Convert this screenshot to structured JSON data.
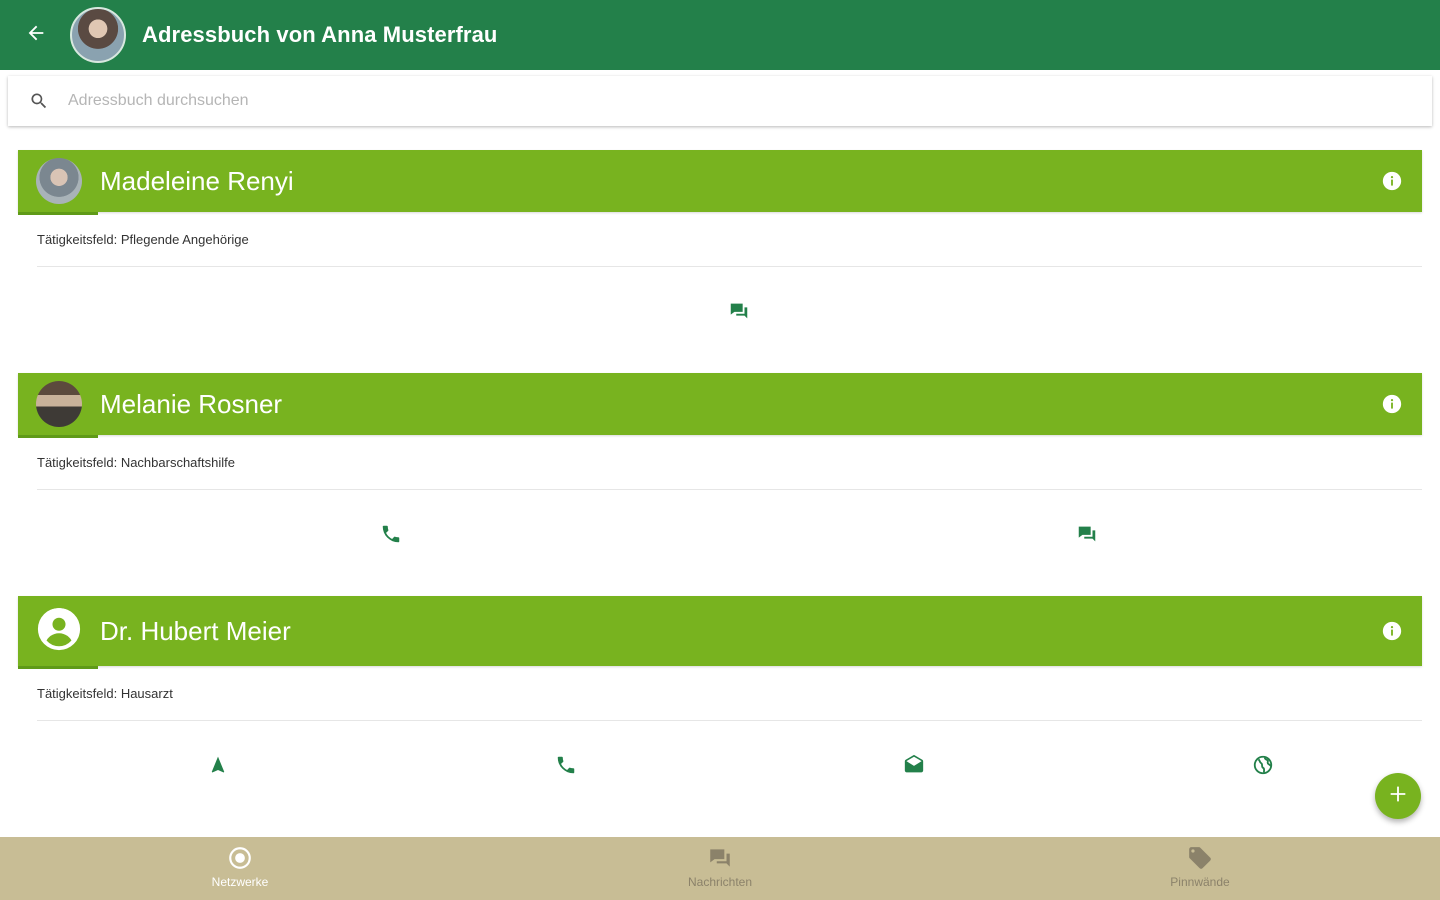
{
  "colors": {
    "primary": "#23804a",
    "card_header": "#78b31f",
    "bottom_nav": "#c8bd95",
    "icon_green": "#23804a"
  },
  "header": {
    "title": "Adressbuch von Anna Musterfrau",
    "back_icon": "arrow-left-icon"
  },
  "search": {
    "placeholder": "Adressbuch durchsuchen",
    "value": "",
    "icon": "search-icon"
  },
  "contacts": [
    {
      "name": "Madeleine Renyi",
      "field": "Tätigkeitsfeld: Pflegende Angehörige",
      "actions": [
        "message-icon"
      ]
    },
    {
      "name": "Melanie Rosner",
      "field": "Tätigkeitsfeld: Nachbarschaftshilfe",
      "actions": [
        "phone-icon",
        "message-icon"
      ]
    },
    {
      "name": "Dr. Hubert Meier",
      "field": "Tätigkeitsfeld: Hausarzt",
      "actions": [
        "navigation-icon",
        "phone-icon",
        "email-icon",
        "globe-icon"
      ]
    }
  ],
  "fab": {
    "icon": "plus-icon"
  },
  "bottom_nav": {
    "items": [
      {
        "label": "Netzwerke",
        "icon": "network-icon",
        "active": true
      },
      {
        "label": "Nachrichten",
        "icon": "chat-icon",
        "active": false
      },
      {
        "label": "Pinnwände",
        "icon": "tag-icon",
        "active": false
      }
    ]
  }
}
